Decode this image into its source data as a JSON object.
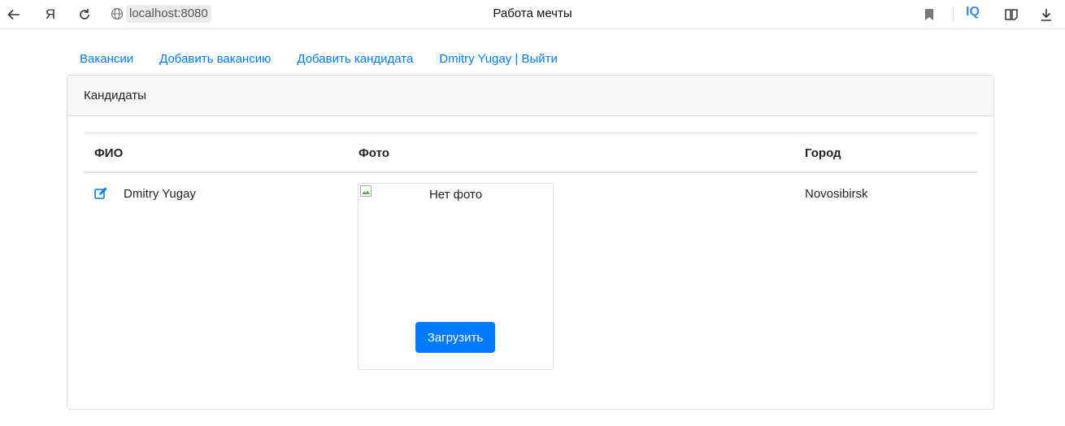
{
  "browser": {
    "url": "localhost:8080",
    "tab_title": "Работа мечты",
    "yandex_glyph": "Я",
    "iq_label": "IQ"
  },
  "nav": {
    "links": [
      "Вакансии",
      "Добавить вакансию",
      "Добавить кандидата",
      "Dmitry Yugay | Выйти"
    ]
  },
  "card": {
    "header": "Кандидаты"
  },
  "table": {
    "headers": [
      "ФИО",
      "Фото",
      "Город"
    ],
    "rows": [
      {
        "name": "Dmitry Yugay",
        "photo_alt": "Нет фото",
        "upload_label": "Загрузить",
        "city": "Novosibirsk"
      }
    ]
  },
  "colors": {
    "link": "#007bff",
    "button": "#007bff",
    "iq": "#3b8ede"
  },
  "icons": [
    "back-arrow-icon",
    "yandex-icon",
    "reload-icon",
    "globe-icon",
    "bookmark-icon",
    "reader-icon",
    "download-icon",
    "edit-icon",
    "broken-image-icon"
  ]
}
